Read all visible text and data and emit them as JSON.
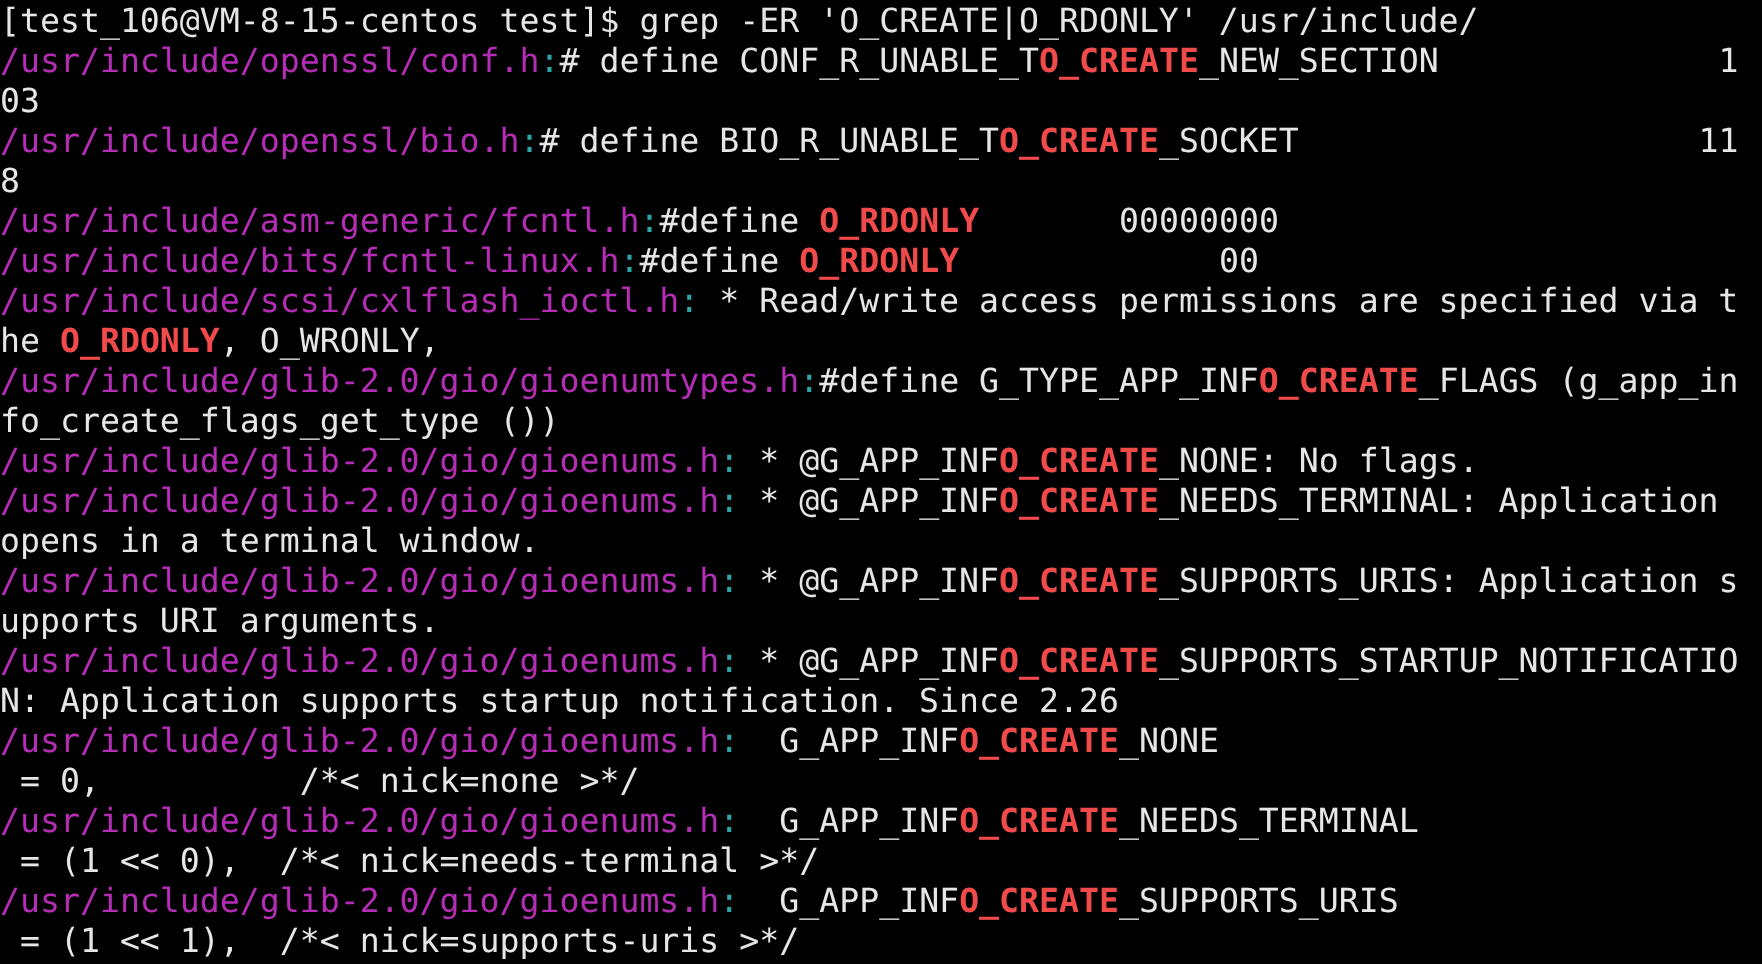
{
  "terminal": {
    "lines": [
      {
        "segments": [
          {
            "kind": "text",
            "text": "[test_106@VM-8-15-centos test]$ grep -ER 'O_CREATE|O_RDONLY' /usr/include/"
          }
        ]
      },
      {
        "segments": [
          {
            "kind": "path",
            "text": "/usr/include/openssl/conf.h"
          },
          {
            "kind": "sep",
            "text": ":"
          },
          {
            "kind": "text",
            "text": "# define CONF_R_UNABLE_T"
          },
          {
            "kind": "match",
            "text": "O_CREATE"
          },
          {
            "kind": "text",
            "text": "_NEW_SECTION              1"
          }
        ]
      },
      {
        "segments": [
          {
            "kind": "text",
            "text": "03"
          }
        ]
      },
      {
        "segments": [
          {
            "kind": "path",
            "text": "/usr/include/openssl/bio.h"
          },
          {
            "kind": "sep",
            "text": ":"
          },
          {
            "kind": "text",
            "text": "# define BIO_R_UNABLE_T"
          },
          {
            "kind": "match",
            "text": "O_CREATE"
          },
          {
            "kind": "text",
            "text": "_SOCKET                    11"
          }
        ]
      },
      {
        "segments": [
          {
            "kind": "text",
            "text": "8"
          }
        ]
      },
      {
        "segments": [
          {
            "kind": "path",
            "text": "/usr/include/asm-generic/fcntl.h"
          },
          {
            "kind": "sep",
            "text": ":"
          },
          {
            "kind": "text",
            "text": "#define "
          },
          {
            "kind": "match",
            "text": "O_RDONLY"
          },
          {
            "kind": "text",
            "text": "       00000000"
          }
        ]
      },
      {
        "segments": [
          {
            "kind": "path",
            "text": "/usr/include/bits/fcntl-linux.h"
          },
          {
            "kind": "sep",
            "text": ":"
          },
          {
            "kind": "text",
            "text": "#define "
          },
          {
            "kind": "match",
            "text": "O_RDONLY"
          },
          {
            "kind": "text",
            "text": "             00"
          }
        ]
      },
      {
        "segments": [
          {
            "kind": "path",
            "text": "/usr/include/scsi/cxlflash_ioctl.h"
          },
          {
            "kind": "sep",
            "text": ":"
          },
          {
            "kind": "text",
            "text": " * Read/write access permissions are specified via t"
          }
        ]
      },
      {
        "segments": [
          {
            "kind": "text",
            "text": "he "
          },
          {
            "kind": "match",
            "text": "O_RDONLY"
          },
          {
            "kind": "text",
            "text": ", O_WRONLY,"
          }
        ]
      },
      {
        "segments": [
          {
            "kind": "path",
            "text": "/usr/include/glib-2.0/gio/gioenumtypes.h"
          },
          {
            "kind": "sep",
            "text": ":"
          },
          {
            "kind": "text",
            "text": "#define G_TYPE_APP_INF"
          },
          {
            "kind": "match",
            "text": "O_CREATE"
          },
          {
            "kind": "text",
            "text": "_FLAGS (g_app_in"
          }
        ]
      },
      {
        "segments": [
          {
            "kind": "text",
            "text": "fo_create_flags_get_type ())"
          }
        ]
      },
      {
        "segments": [
          {
            "kind": "path",
            "text": "/usr/include/glib-2.0/gio/gioenums.h"
          },
          {
            "kind": "sep",
            "text": ":"
          },
          {
            "kind": "text",
            "text": " * @G_APP_INF"
          },
          {
            "kind": "match",
            "text": "O_CREATE"
          },
          {
            "kind": "text",
            "text": "_NONE: No flags."
          }
        ]
      },
      {
        "segments": [
          {
            "kind": "path",
            "text": "/usr/include/glib-2.0/gio/gioenums.h"
          },
          {
            "kind": "sep",
            "text": ":"
          },
          {
            "kind": "text",
            "text": " * @G_APP_INF"
          },
          {
            "kind": "match",
            "text": "O_CREATE"
          },
          {
            "kind": "text",
            "text": "_NEEDS_TERMINAL: Application"
          }
        ]
      },
      {
        "segments": [
          {
            "kind": "text",
            "text": "opens in a terminal window."
          }
        ]
      },
      {
        "segments": [
          {
            "kind": "path",
            "text": "/usr/include/glib-2.0/gio/gioenums.h"
          },
          {
            "kind": "sep",
            "text": ":"
          },
          {
            "kind": "text",
            "text": " * @G_APP_INF"
          },
          {
            "kind": "match",
            "text": "O_CREATE"
          },
          {
            "kind": "text",
            "text": "_SUPPORTS_URIS: Application s"
          }
        ]
      },
      {
        "segments": [
          {
            "kind": "text",
            "text": "upports URI arguments."
          }
        ]
      },
      {
        "segments": [
          {
            "kind": "path",
            "text": "/usr/include/glib-2.0/gio/gioenums.h"
          },
          {
            "kind": "sep",
            "text": ":"
          },
          {
            "kind": "text",
            "text": " * @G_APP_INF"
          },
          {
            "kind": "match",
            "text": "O_CREATE"
          },
          {
            "kind": "text",
            "text": "_SUPPORTS_STARTUP_NOTIFICATIO"
          }
        ]
      },
      {
        "segments": [
          {
            "kind": "text",
            "text": "N: Application supports startup notification. Since 2.26"
          }
        ]
      },
      {
        "segments": [
          {
            "kind": "path",
            "text": "/usr/include/glib-2.0/gio/gioenums.h"
          },
          {
            "kind": "sep",
            "text": ":"
          },
          {
            "kind": "text",
            "text": "  G_APP_INF"
          },
          {
            "kind": "match",
            "text": "O_CREATE"
          },
          {
            "kind": "text",
            "text": "_NONE"
          }
        ]
      },
      {
        "segments": [
          {
            "kind": "text",
            "text": " = 0,          /*< nick=none >*/"
          }
        ]
      },
      {
        "segments": [
          {
            "kind": "path",
            "text": "/usr/include/glib-2.0/gio/gioenums.h"
          },
          {
            "kind": "sep",
            "text": ":"
          },
          {
            "kind": "text",
            "text": "  G_APP_INF"
          },
          {
            "kind": "match",
            "text": "O_CREATE"
          },
          {
            "kind": "text",
            "text": "_NEEDS_TERMINAL"
          }
        ]
      },
      {
        "segments": [
          {
            "kind": "text",
            "text": " = (1 << 0),  /*< nick=needs-terminal >*/"
          }
        ]
      },
      {
        "segments": [
          {
            "kind": "path",
            "text": "/usr/include/glib-2.0/gio/gioenums.h"
          },
          {
            "kind": "sep",
            "text": ":"
          },
          {
            "kind": "text",
            "text": "  G_APP_INF"
          },
          {
            "kind": "match",
            "text": "O_CREATE"
          },
          {
            "kind": "text",
            "text": "_SUPPORTS_URIS"
          }
        ]
      },
      {
        "segments": [
          {
            "kind": "text",
            "text": " = (1 << 1),  /*< nick=supports-uris >*/"
          }
        ]
      }
    ]
  }
}
